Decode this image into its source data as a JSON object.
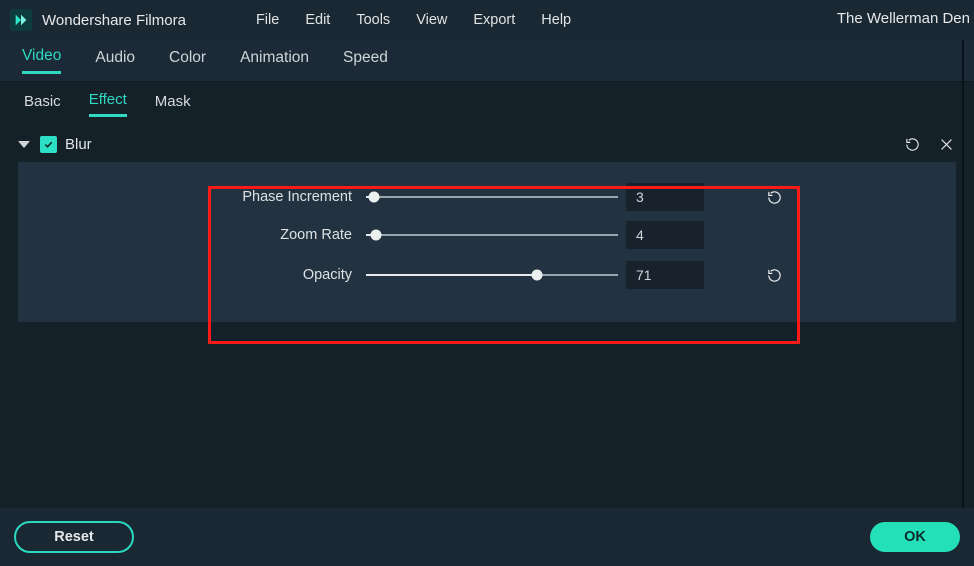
{
  "app": {
    "name": "Wondershare Filmora"
  },
  "project_title": "The Wellerman Den",
  "menubar": {
    "items": [
      "File",
      "Edit",
      "Tools",
      "View",
      "Export",
      "Help"
    ]
  },
  "primary_tabs": {
    "items": [
      "Video",
      "Audio",
      "Color",
      "Animation",
      "Speed"
    ],
    "active": 0
  },
  "secondary_tabs": {
    "items": [
      "Basic",
      "Effect",
      "Mask"
    ],
    "active": 1
  },
  "section": {
    "label": "Blur",
    "checked": true
  },
  "params": {
    "phase_increment": {
      "label": "Phase Increment",
      "value": "3",
      "percent": 3,
      "has_reset": true
    },
    "zoom_rate": {
      "label": "Zoom Rate",
      "value": "4",
      "percent": 4,
      "has_reset": false
    },
    "opacity": {
      "label": "Opacity",
      "value": "71",
      "percent": 68,
      "has_reset": true
    }
  },
  "footer": {
    "reset": "Reset",
    "ok": "OK"
  }
}
